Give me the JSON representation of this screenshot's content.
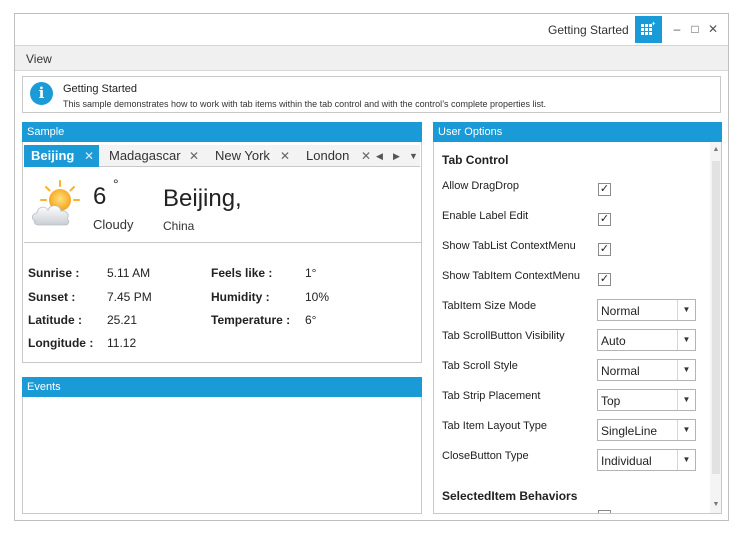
{
  "window": {
    "title": "Getting Started",
    "controls": {
      "minimize": "–",
      "maximize": "□",
      "close": "✕"
    }
  },
  "menu": {
    "view": "View"
  },
  "info": {
    "icon": "info-icon",
    "title": "Getting Started",
    "description": "This sample demonstrates how to work with tab items within the tab control and with the control’s complete properties list."
  },
  "sample": {
    "header": "Sample",
    "tabs": [
      {
        "label": "Beijing",
        "active": true
      },
      {
        "label": "Madagascar",
        "active": false
      },
      {
        "label": "New York",
        "active": false
      },
      {
        "label": "London",
        "active": false
      }
    ],
    "weather": {
      "icon": "cloud-sun-icon",
      "temperature": "6",
      "degree": "°",
      "condition": "Cloudy",
      "city": "Beijing,",
      "country": "China"
    },
    "details": {
      "sunrise_label": "Sunrise :",
      "sunrise": "5.11 AM",
      "sunset_label": "Sunset :",
      "sunset": "7.45 PM",
      "latitude_label": "Latitude :",
      "latitude": "25.21",
      "longitude_label": "Longitude :",
      "longitude": "11.12",
      "feels_label": "Feels like :",
      "feels": "1°",
      "humidity_label": "Humidity :",
      "humidity": "10%",
      "temperature_label": "Temperature :",
      "temperature": "6°"
    }
  },
  "events": {
    "header": "Events"
  },
  "options": {
    "header": "User Options",
    "section_tab_control": "Tab Control",
    "checkboxes": [
      {
        "label": "Allow DragDrop",
        "checked": true
      },
      {
        "label": "Enable Label Edit",
        "checked": true
      },
      {
        "label": "Show TabList ContextMenu",
        "checked": true
      },
      {
        "label": "Show TabItem ContextMenu",
        "checked": true
      }
    ],
    "selects": [
      {
        "label": "TabItem Size Mode",
        "value": "Normal"
      },
      {
        "label": "Tab ScrollButton Visibility",
        "value": "Auto"
      },
      {
        "label": "Tab Scroll Style",
        "value": "Normal"
      },
      {
        "label": "Tab Strip Placement",
        "value": "Top"
      },
      {
        "label": "Tab Item Layout Type",
        "value": "SingleLine"
      },
      {
        "label": "CloseButton Type",
        "value": "Individual"
      }
    ],
    "section_selected_item": "SelectedItem Behaviors"
  },
  "colors": {
    "accent": "#1a9ad6"
  }
}
